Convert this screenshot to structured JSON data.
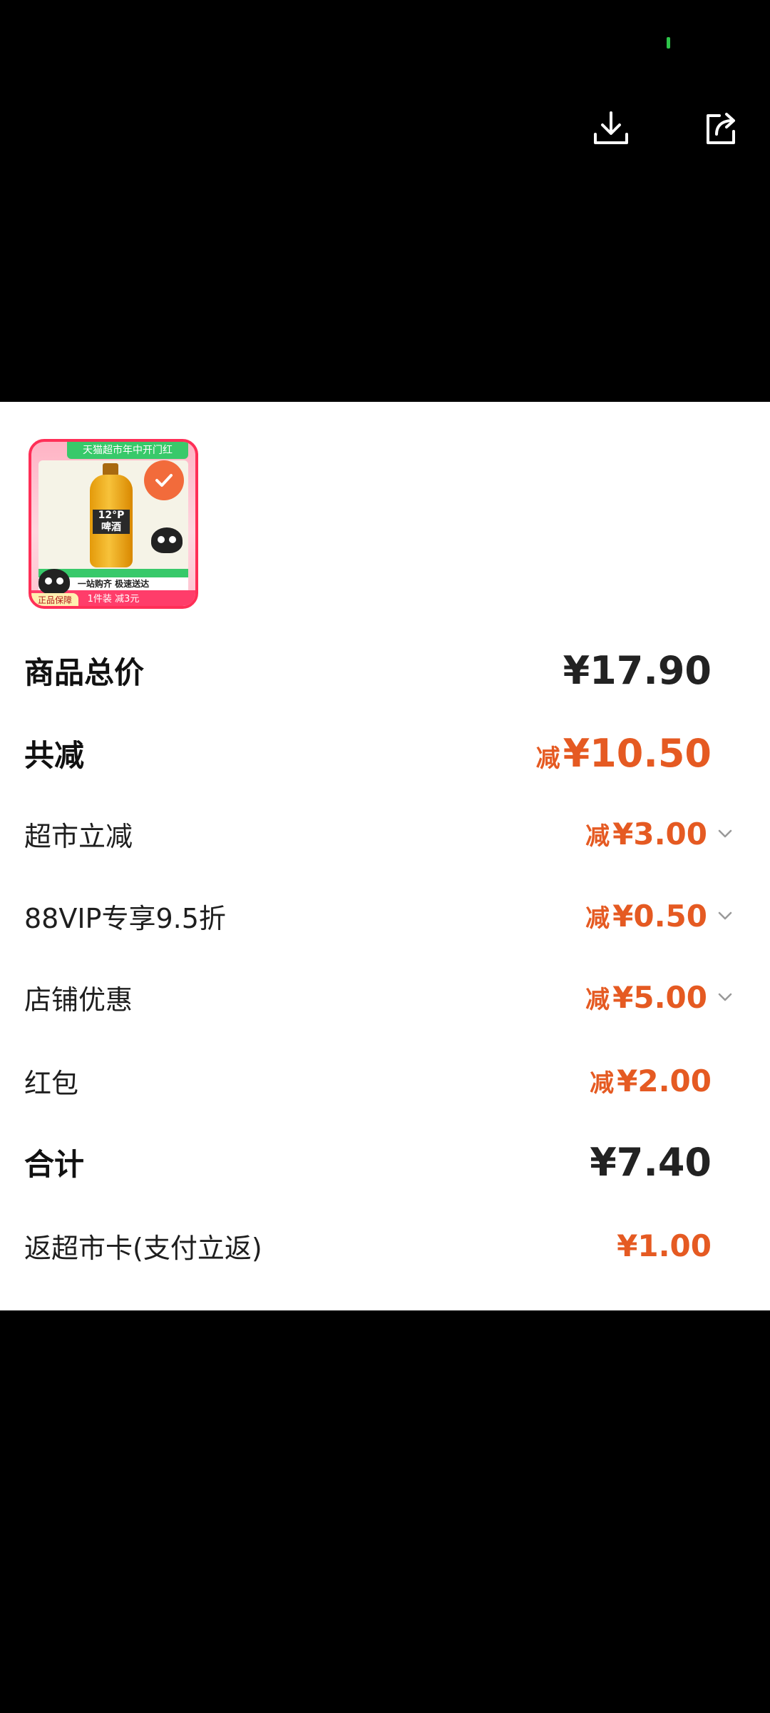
{
  "top_bar": {
    "download_icon": "download-icon",
    "share_icon": "share-icon"
  },
  "product": {
    "banner_text": "天猫超市年中开门红",
    "bottle_label": "12°P 啤酒",
    "bottom_strip": "一站购齐 极速送达",
    "promo_strip": "1件装 减3元",
    "guarantee": "正品保障"
  },
  "summary": {
    "total_label": "商品总价",
    "total_amount": "¥17.90",
    "discount_label": "共减",
    "discount_prefix": "减",
    "discount_amount": "¥10.50",
    "items": [
      {
        "label": "超市立减",
        "prefix": "减",
        "amount": "¥3.00",
        "expandable": true
      },
      {
        "label": "88VIP专享9.5折",
        "prefix": "减",
        "amount": "¥0.50",
        "expandable": true
      },
      {
        "label": "店铺优惠",
        "prefix": "减",
        "amount": "¥5.00",
        "expandable": true
      },
      {
        "label": "红包",
        "prefix": "减",
        "amount": "¥2.00",
        "expandable": false
      }
    ],
    "sum_label": "合计",
    "sum_amount": "¥7.40",
    "rebate_label": "返超市卡(支付立返)",
    "rebate_amount": "¥1.00"
  },
  "colors": {
    "accent": "#e55a22",
    "card_bg": "#ffffff",
    "page_bg": "#000000"
  }
}
